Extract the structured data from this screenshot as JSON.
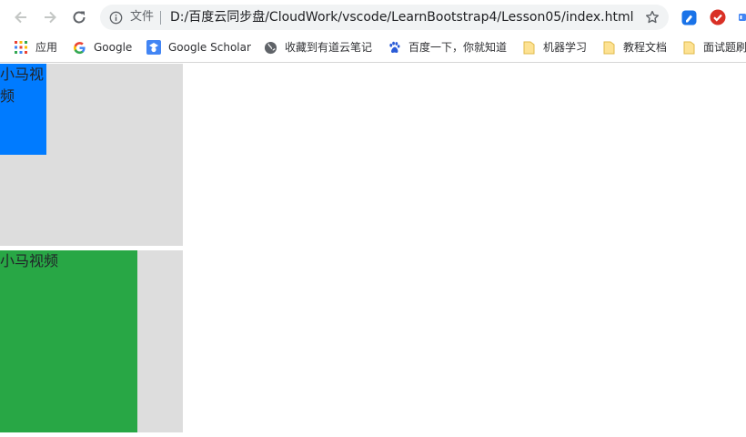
{
  "browser": {
    "address_file_label": "文件",
    "url": "D:/百度云同步盘/CloudWork/vscode/LearnBootstrap4/Lesson05/index.html"
  },
  "bookmarks": [
    {
      "label": "应用",
      "icon": "apps-grid-icon"
    },
    {
      "label": "Google",
      "icon": "google-icon"
    },
    {
      "label": "Google Scholar",
      "icon": "google-scholar-icon"
    },
    {
      "label": "收藏到有道云笔记",
      "icon": "globe-icon"
    },
    {
      "label": "百度一下，你就知道",
      "icon": "baidu-paw-icon"
    },
    {
      "label": "机器学习",
      "icon": "folder-icon"
    },
    {
      "label": "教程文档",
      "icon": "folder-icon"
    },
    {
      "label": "面试题刷",
      "icon": "folder-icon"
    }
  ],
  "page": {
    "box1": {
      "text": "小马视频",
      "outer_color": "#dddddd",
      "inner_color": "#007bff"
    },
    "box2": {
      "text": "小马视频",
      "outer_color": "#dddddd",
      "inner_color": "#28a745"
    }
  }
}
